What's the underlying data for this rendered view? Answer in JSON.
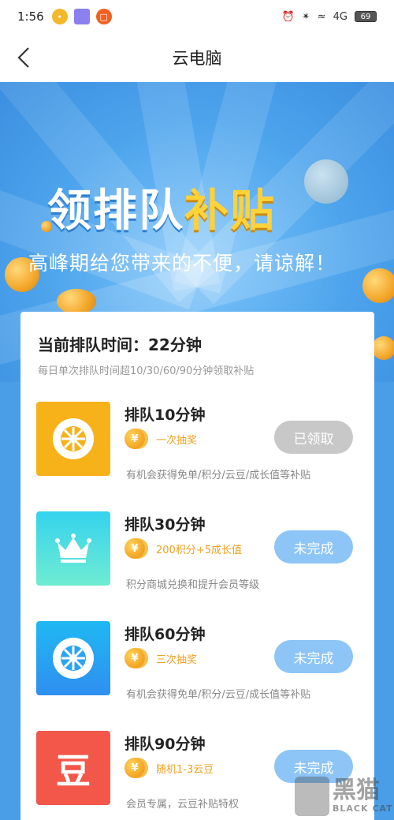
{
  "status_bar": {
    "time": "1:56",
    "network": "4G",
    "battery": "69"
  },
  "nav": {
    "title": "云电脑"
  },
  "banner": {
    "headline_white": "领排队",
    "headline_yellow": "补贴",
    "subtitle": "高峰期给您带来的不便，请谅解！"
  },
  "queue": {
    "title": "当前排队时间：22分钟",
    "description": "每日单次排队时间超10/30/60/90分钟领取补贴"
  },
  "tasks": [
    {
      "name": "排队10分钟",
      "reward": "一次抽奖",
      "note": "有机会获得免单/积分/云豆/成长值等补贴",
      "button": "已领取",
      "status": "claimed",
      "icon": "wheel-icon",
      "icon_bg": "#f7b21a"
    },
    {
      "name": "排队30分钟",
      "reward": "200积分+5成长值",
      "note": "积分商城兑换和提升会员等级",
      "button": "未完成",
      "status": "pending",
      "icon": "crown-icon",
      "icon_bg": "#3fd8e6"
    },
    {
      "name": "排队60分钟",
      "reward": "三次抽奖",
      "note": "有机会获得免单/积分/云豆/成长值等补贴",
      "button": "未完成",
      "status": "pending",
      "icon": "wheel-icon",
      "icon_bg": "#2aa3f0"
    },
    {
      "name": "排队90分钟",
      "reward": "随机1-3云豆",
      "note": "会员专属，云豆补贴特权",
      "button": "未完成",
      "status": "pending",
      "icon": "bean-icon",
      "icon_bg": "#f2574a",
      "icon_text": "豆"
    }
  ],
  "coin_symbol": "¥",
  "watermark": {
    "cn": "黑猫",
    "en": "BLACK CAT"
  },
  "colors": {
    "accent_blue": "#4a9ee8",
    "button_pending": "#8cc5f6",
    "button_claimed": "#c8c8c8",
    "reward_orange": "#f0a020"
  }
}
